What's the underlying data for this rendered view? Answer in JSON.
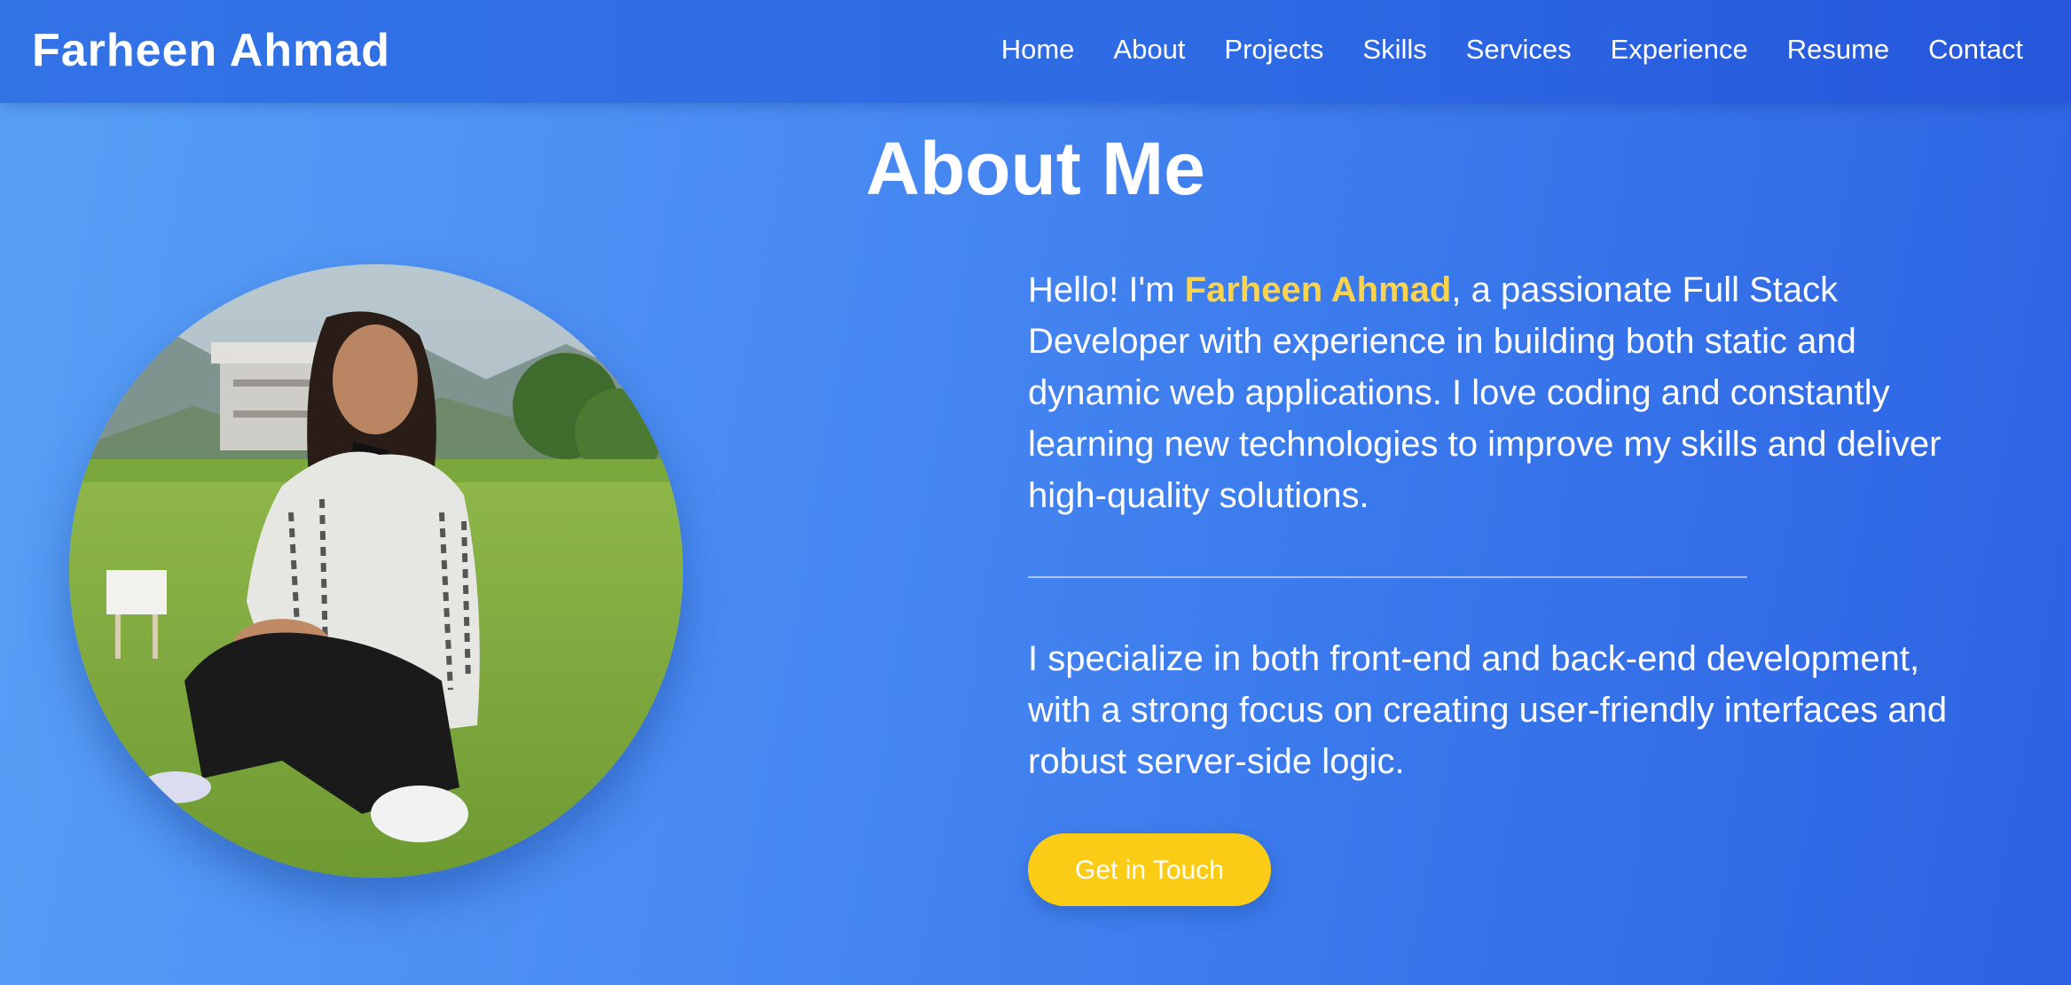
{
  "header": {
    "brand": "Farheen Ahmad",
    "nav": [
      "Home",
      "About",
      "Projects",
      "Skills",
      "Services",
      "Experience",
      "Resume",
      "Contact"
    ]
  },
  "about": {
    "title": "About Me",
    "intro_prefix": "Hello! I'm ",
    "intro_name": "Farheen Ahmad",
    "intro_suffix": ", a passionate Full Stack Developer with experience in building both static and dynamic web applications. I love coding and constantly learning new technologies to improve my skills and deliver high-quality solutions.",
    "specialty": "I specialize in both front-end and back-end development, with a strong focus on creating user-friendly interfaces and robust server-side logic.",
    "cta_label": "Get in Touch"
  },
  "colors": {
    "accent": "#facc15",
    "name_highlight": "#fcd34d",
    "background_start": "#58a0f6",
    "background_end": "#2c62e2"
  }
}
